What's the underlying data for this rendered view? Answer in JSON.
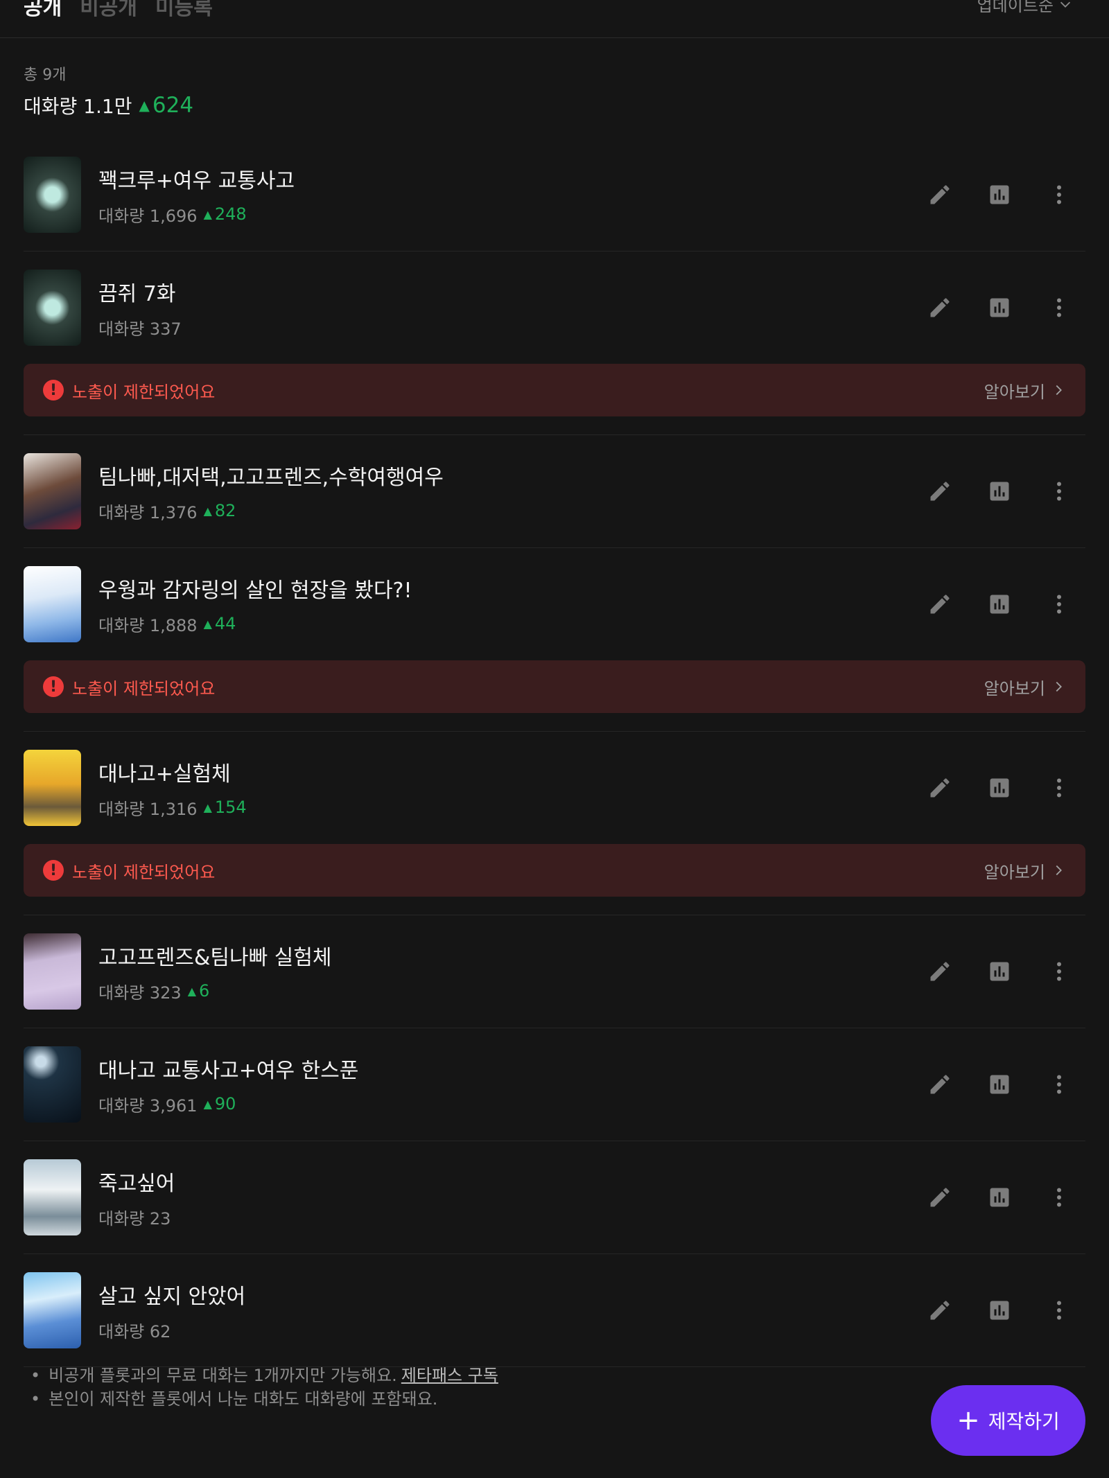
{
  "tabs": [
    "공개",
    "비공개",
    "미등록"
  ],
  "sort_label": "업데이트순",
  "summary": {
    "total": "총 9개",
    "volume_label": "대화량 1.1만",
    "volume_delta": "624"
  },
  "items": [
    {
      "title": "꽥크루+여우 교통사고",
      "count": "대화량 1,696",
      "inc": "248",
      "warning": false
    },
    {
      "title": "끔쥐 7화",
      "count": "대화량 337",
      "inc": "",
      "warning": true
    },
    {
      "title": "팀나빠,대저택,고고프렌즈,수학여행여우",
      "count": "대화량 1,376",
      "inc": "82",
      "warning": false
    },
    {
      "title": "우웡과 감자링의 살인 현장을 봤다?!",
      "count": "대화량 1,888",
      "inc": "44",
      "warning": true
    },
    {
      "title": "대나고+실험체",
      "count": "대화량 1,316",
      "inc": "154",
      "warning": true
    },
    {
      "title": "고고프렌즈&팀나빠 실험체",
      "count": "대화량 323",
      "inc": "6",
      "warning": false
    },
    {
      "title": "대나고 교통사고+여우 한스푼",
      "count": "대화량 3,961",
      "inc": "90",
      "warning": false
    },
    {
      "title": "죽고싶어",
      "count": "대화량 23",
      "inc": "",
      "warning": false
    },
    {
      "title": "살고 싶지 안았어",
      "count": "대화량 62",
      "inc": "",
      "warning": false
    }
  ],
  "warning": {
    "text": "노출이 제한되었어요",
    "link": "알아보기"
  },
  "footer": {
    "line1": "비공개 플롯과의 무료 대화는 1개까지만 가능해요.",
    "line1_link": "제타패스 구독",
    "line2": "본인이 제작한 플롯에서 나눈 대화도 대화량에 포함돼요."
  },
  "fab_label": "제작하기",
  "colors": {
    "accent": "#6b2ff0",
    "positive": "#1fb05a",
    "warning_bg": "#3a1d1e",
    "warning_text": "#ff5a4f"
  },
  "icons": [
    "edit-icon",
    "stats-icon",
    "more-icon",
    "chevron-right-icon",
    "chevron-down-icon",
    "alert-icon",
    "plus-icon"
  ]
}
